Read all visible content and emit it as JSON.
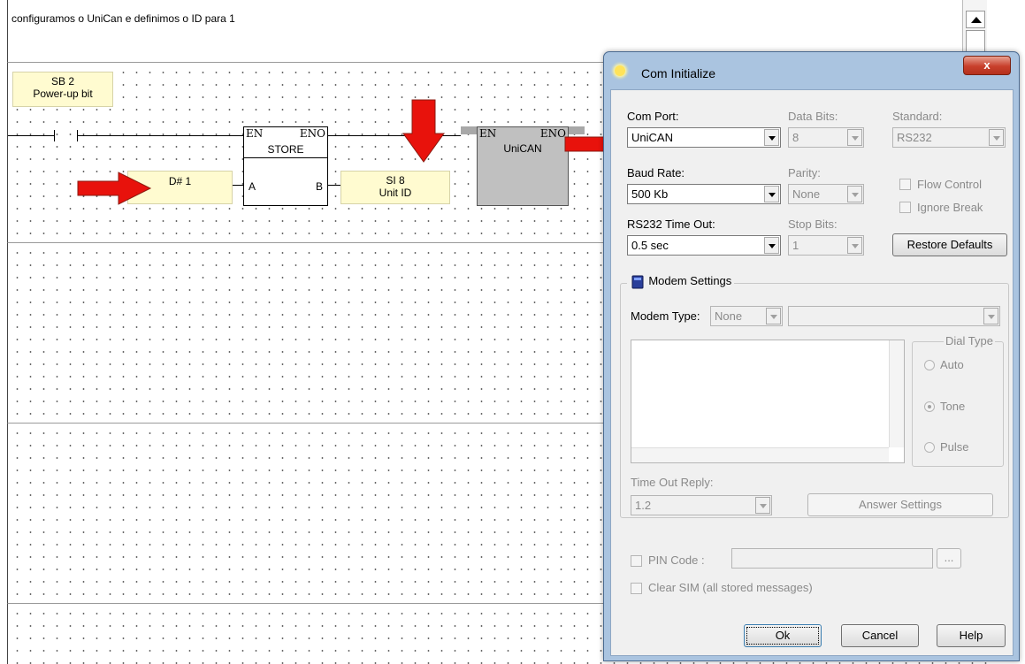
{
  "editor": {
    "comment": "configuramos o  UniCan e definimos o ID para 1",
    "contact": {
      "operand": "SB 2",
      "description": "Power-up bit"
    },
    "store_block": {
      "en": "EN",
      "eno": "ENO",
      "name": "STORE",
      "pin_a": "A",
      "pin_b": "B"
    },
    "source_operand": "D# 1",
    "target_operand": {
      "name": "SI 8",
      "description": "Unit ID"
    },
    "unican_block": {
      "en": "EN",
      "eno": "ENO",
      "name": "UniCAN"
    }
  },
  "dialog": {
    "title": "Com Initialize",
    "close": "x",
    "com_port": {
      "label": "Com Port:",
      "value": "UniCAN"
    },
    "data_bits": {
      "label": "Data Bits:",
      "value": "8"
    },
    "standard": {
      "label": "Standard:",
      "value": "RS232"
    },
    "baud_rate": {
      "label": "Baud Rate:",
      "value": "500 Kb"
    },
    "parity": {
      "label": "Parity:",
      "value": "None"
    },
    "flow_control": "Flow Control",
    "ignore_break": "Ignore Break",
    "rs232_timeout": {
      "label": "RS232 Time Out:",
      "value": "0.5 sec"
    },
    "stop_bits": {
      "label": "Stop Bits:",
      "value": "1"
    },
    "restore_defaults": "Restore Defaults",
    "modem_settings": "Modem Settings",
    "modem_type": {
      "label": "Modem Type:",
      "value": "None"
    },
    "dial_type": {
      "label": "Dial Type",
      "auto": "Auto",
      "tone": "Tone",
      "pulse": "Pulse",
      "selected": "Tone"
    },
    "time_out_reply": {
      "label": "Time Out Reply:",
      "value": "1.2"
    },
    "answer_settings": "Answer Settings",
    "pin_code": "PIN Code :",
    "pin_browse": "...",
    "clear_sim": "Clear SIM (all stored messages)",
    "ok": "Ok",
    "cancel": "Cancel",
    "help": "Help"
  },
  "colors": {
    "arrow": "#e8120c",
    "operand_bg": "#fffbd0",
    "dialog_frame": "#aac4e0"
  },
  "icons": [
    "scroll-up-icon",
    "sun-icon",
    "close-icon",
    "arrow-right-icon",
    "arrow-down-icon",
    "modem-book-icon",
    "dropdown-arrow-icon"
  ]
}
